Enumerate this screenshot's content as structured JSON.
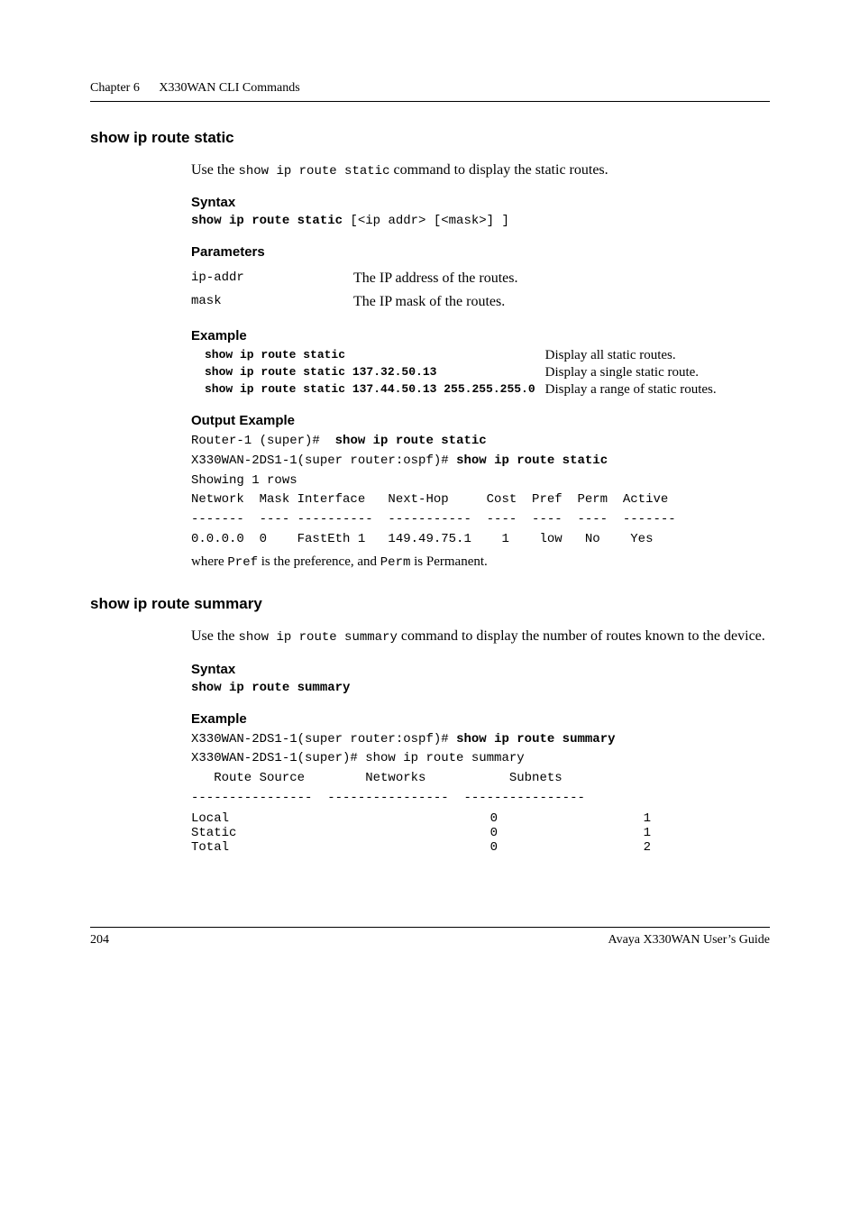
{
  "chapter": {
    "label": "Chapter 6",
    "title": "X330WAN CLI Commands"
  },
  "section_static": {
    "heading": "show ip route static",
    "intro_pre": "Use the ",
    "intro_cmd": "show ip route static",
    "intro_post": " command to display the static routes.",
    "syntax_label": "Syntax",
    "syntax_bold": "show ip route static",
    "syntax_args": " [<ip addr> [<mask>] ]",
    "parameters_label": "Parameters",
    "params": [
      {
        "name": "ip-addr",
        "desc": "The IP address of the routes."
      },
      {
        "name": "mask",
        "desc": "The IP mask of the routes."
      }
    ],
    "example_label": "Example",
    "examples": [
      {
        "cmd": "show ip route static",
        "explain": "Display all static routes."
      },
      {
        "cmd": "show ip route static 137.32.50.13",
        "explain": "Display a single static route."
      },
      {
        "cmd": "show ip route static 137.44.50.13 255.255.255.0",
        "explain": "Display a range of static routes."
      }
    ],
    "output_example_label": "Output Example",
    "code_line1_pre": "Router-1 (super)#  ",
    "code_line1_bold": "show ip route static",
    "code_line2_pre": "X330WAN-2DS1-1(super router:ospf)# ",
    "code_line2_bold": "show ip route static",
    "code_body": "Showing 1 rows\nNetwork  Mask Interface   Next-Hop     Cost  Pref  Perm  Active\n-------  ---- ----------  -----------  ----  ----  ----  -------\n0.0.0.0  0    FastEth 1   149.49.75.1    1    low   No    Yes",
    "where_a": "where ",
    "where_pref": "Pref",
    "where_b": " is the preference, and ",
    "where_perm": "Perm",
    "where_c": " is Permanent."
  },
  "section_summary": {
    "heading": "show ip route summary",
    "intro_pre": "Use the ",
    "intro_cmd": "show ip route summary",
    "intro_post": " command to display the number of routes known to the device.",
    "syntax_label": "Syntax",
    "syntax_bold": "show ip route summary",
    "example_label": "Example",
    "code_line1_pre": "X330WAN-2DS1-1(super router:ospf)# ",
    "code_line1_bold": "show ip route summary",
    "code_body_top": "X330WAN-2DS1-1(super)# show ip route summary\n   Route Source        Networks           Subnets\n----------------  ----------------  ----------------",
    "table": [
      {
        "source": "Local",
        "networks": "0",
        "subnets": "1"
      },
      {
        "source": "Static",
        "networks": "0",
        "subnets": "1"
      },
      {
        "source": "Total",
        "networks": "0",
        "subnets": "2"
      }
    ]
  },
  "footer": {
    "page": "204",
    "guide": "Avaya X330WAN User’s Guide"
  }
}
